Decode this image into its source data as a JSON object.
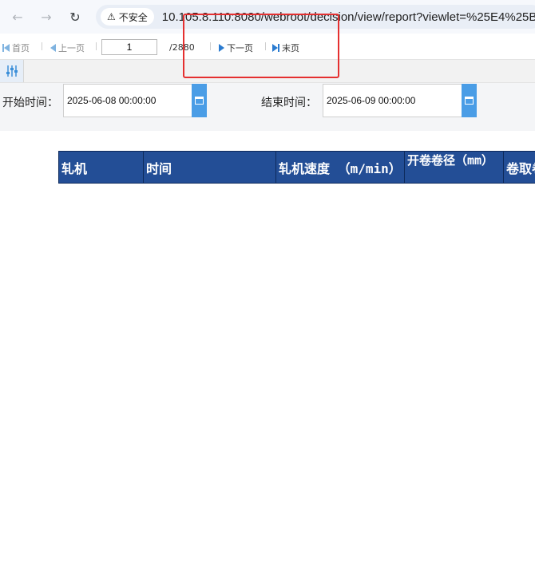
{
  "browser": {
    "security_label": "不安全",
    "url": "10.105.8.110:8080/webroot/decision/view/report?viewlet=%25E4%25B"
  },
  "pager": {
    "first_label": "首页",
    "prev_label": "上一页",
    "current_page": "1",
    "total_pages": "/2880",
    "next_label": "下一页",
    "last_label": "末页"
  },
  "params": {
    "start_label": "开始时间：",
    "start_value": "2025-06-08 00:00:00",
    "end_label": "结束时间：",
    "end_value": "2025-06-09 00:00:00"
  },
  "table": {
    "headers": [
      "轧机",
      "时间",
      "轧机速度 （m/min）",
      "开卷卷径（mm）",
      "卷取卷"
    ]
  },
  "colors": {
    "header_bg": "#234e96",
    "calendar_btn": "#4a9de6",
    "highlight": "#e53030"
  },
  "icons": [
    "back-arrow-icon",
    "forward-arrow-icon",
    "reload-icon",
    "warning-icon",
    "first-page-icon",
    "prev-page-icon",
    "next-page-icon",
    "last-page-icon",
    "settings-sliders-icon",
    "calendar-icon"
  ]
}
